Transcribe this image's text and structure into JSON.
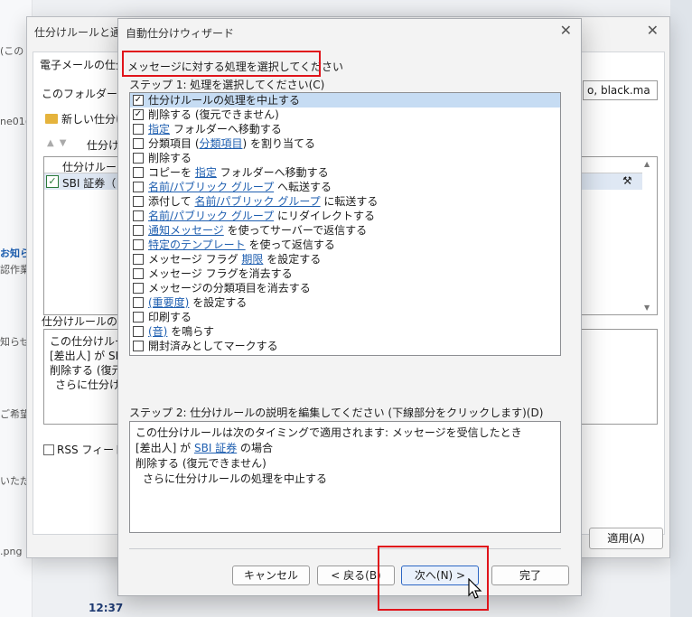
{
  "background": {
    "left_fragments": [
      "(この",
      "ne01(",
      "お知ら",
      "認作業",
      "知らせ",
      "ご希望",
      "いただ",
      ".png"
    ],
    "time": "12:37"
  },
  "rules_dialog": {
    "title": "仕分けルールと通知",
    "tab": "電子メールの仕分",
    "folder_label": "このフォルダーに変",
    "combo_value": "o, black.ma",
    "new_rule": "新しい仕分け",
    "sort_label": "仕分け",
    "list_header": "仕分けルール",
    "rule_name": "SBI 証券（",
    "desc_label": "仕分けルールの説",
    "desc_lines": [
      "この仕分けルー",
      "[差出人] が SBI",
      "削除する (復元",
      "さらに仕分けル"
    ],
    "rss_label": "RSS フィードか",
    "apply": "適用(A)"
  },
  "wizard": {
    "title": "自動仕分けウィザード",
    "heading": "メッセージに対する処理を選択してください",
    "step1": "ステップ 1: 処理を選択してください(C)",
    "actions": [
      {
        "label": "仕分けルールの処理を中止する",
        "checked": true,
        "selected": true
      },
      {
        "label": "削除する (復元できません)",
        "checked": true
      },
      {
        "label": "指定 フォルダーへ移動する",
        "checked": false
      },
      {
        "label": "分類項目 (分類項目) を割り当てる",
        "checked": false
      },
      {
        "label": "削除する",
        "checked": false
      },
      {
        "label": "コピーを 指定 フォルダーへ移動する",
        "checked": false
      },
      {
        "label": "名前/パブリック グループ へ転送する",
        "checked": false
      },
      {
        "label": "添付して 名前/パブリック グループ に転送する",
        "checked": false
      },
      {
        "label": "名前/パブリック グループ にリダイレクトする",
        "checked": false
      },
      {
        "label": "通知メッセージ を使ってサーバーで返信する",
        "checked": false
      },
      {
        "label": "特定のテンプレート を使って返信する",
        "checked": false
      },
      {
        "label": "メッセージ フラグ 期限 を設定する",
        "checked": false
      },
      {
        "label": "メッセージ フラグを消去する",
        "checked": false
      },
      {
        "label": "メッセージの分類項目を消去する",
        "checked": false
      },
      {
        "label": "(重要度) を設定する",
        "checked": false
      },
      {
        "label": "印刷する",
        "checked": false
      },
      {
        "label": "(音) を鳴らす",
        "checked": false
      },
      {
        "label": "開封済みとしてマークする",
        "checked": false
      }
    ],
    "step2": "ステップ 2: 仕分けルールの説明を編集してください (下線部分をクリックします)(D)",
    "desc": {
      "line1": "この仕分けルールは次のタイミングで適用されます: メッセージを受信したとき",
      "line2_prefix": "[差出人] が ",
      "line2_link": "SBI 証券",
      "line2_suffix": " の場合",
      "line3": "削除する (復元できません)",
      "line4": "さらに仕分けルールの処理を中止する"
    },
    "buttons": {
      "cancel": "キャンセル",
      "back": "< 戻る(B)",
      "next": "次へ(N) >",
      "finish": "完了"
    }
  }
}
